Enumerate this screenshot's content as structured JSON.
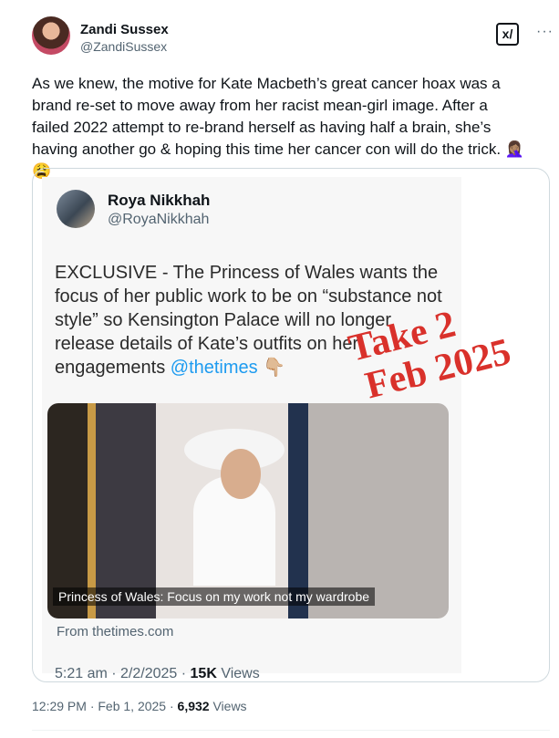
{
  "author": {
    "name": "Zandi Sussex",
    "handle": "@ZandiSussex"
  },
  "header": {
    "grok_label": "x/",
    "more": "···"
  },
  "tweet": {
    "text": "As we knew, the motive for Kate Macbeth’s great cancer hoax was a brand re-set to move away from her racist mean-girl image. After a failed 2022 attempt to re-brand herself as having half a brain, she’s having another go & hoping this time her cancer con will do the trick. 🤦🏽‍♀️😩"
  },
  "quoted": {
    "author_name": "Roya Nikkhah",
    "author_handle": "@RoyaNikkhah",
    "text": "EXCLUSIVE - The Princess of Wales wants the focus of her public work to be on “substance not style” so Kensington Palace will no longer release details of Kate’s outfits on her engagements ",
    "mention": "@thetimes",
    "pointer_emoji": "👇🏼",
    "overlay_line1": "Take 2",
    "overlay_line2": "Feb 2025",
    "image_caption": "Princess of Wales: Focus on my work not my wardrobe",
    "source": "From thetimes.com",
    "time": "5:21 am · 2/2/2025 · ",
    "views_count": "15K",
    "views_label": " Views"
  },
  "meta": {
    "time": "12:29 PM · Feb 1, 2025 · ",
    "views_count": "6,932",
    "views_label": " Views"
  }
}
